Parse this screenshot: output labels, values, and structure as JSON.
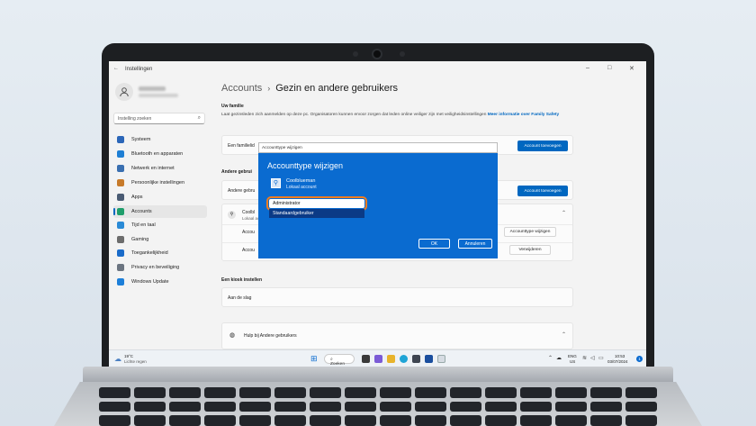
{
  "window": {
    "back_glyph": "←",
    "title": "Instellingen",
    "min": "–",
    "max": "□",
    "close": "✕"
  },
  "sidebar": {
    "search_placeholder": "Instelling zoeken",
    "items": [
      {
        "label": "Systeem",
        "icon": "monitor-icon",
        "color": "#2b66b8"
      },
      {
        "label": "Bluetooth en apparaten",
        "icon": "bluetooth-icon",
        "color": "#1f7fd4"
      },
      {
        "label": "Netwerk en internet",
        "icon": "wifi-icon",
        "color": "#3a6fb0"
      },
      {
        "label": "Persoonlijke instellingen",
        "icon": "brush-icon",
        "color": "#c77a2a"
      },
      {
        "label": "Apps",
        "icon": "apps-icon",
        "color": "#4a5b73"
      },
      {
        "label": "Accounts",
        "icon": "accounts-icon",
        "color": "#1f9e6b"
      },
      {
        "label": "Tijd en taal",
        "icon": "globe-icon",
        "color": "#2a8ad6"
      },
      {
        "label": "Gaming",
        "icon": "gamepad-icon",
        "color": "#6c6c6c"
      },
      {
        "label": "Toegankelijkheid",
        "icon": "accessibility-icon",
        "color": "#1a6bc9"
      },
      {
        "label": "Privacy en beveiliging",
        "icon": "shield-icon",
        "color": "#6b7480"
      },
      {
        "label": "Windows Update",
        "icon": "update-icon",
        "color": "#1d7fd9"
      }
    ],
    "active_index": 5
  },
  "main": {
    "breadcrumb_parent": "Accounts",
    "breadcrumb_sep": "›",
    "page_title": "Gezin en andere gebruikers",
    "family_heading": "Uw familie",
    "family_desc": "Laat gezinsleden zich aanmelden op deze pc. Organisatoren kunnen ervoor zorgen dat leden online veiliger zijn met veiligheidsinstellingen",
    "family_link": "Meer informatie over Family Safety",
    "family_card_label": "Een familielid",
    "add_account_label": "Account toevoegen",
    "other_heading": "Andere gebrui",
    "other_card_label": "Andere gebru",
    "other_add_label": "Account toevoegen",
    "user_name": "Coolbl",
    "user_sub": "Lokaal ac",
    "account_opt_label": "Accou",
    "account_data_label": "Accou",
    "change_type_label": "Accounttype wijzigen",
    "remove_label": "Verwijderen",
    "kiosk_heading": "Een kiosk instellen",
    "kiosk_card_label": "Aan de slag",
    "help_label": "Hulp bij Andere gebruikers"
  },
  "dialog": {
    "input_value": "Accounttype wijzigen",
    "title": "Accounttype wijzigen",
    "user_name": "Coolblueman",
    "user_type": "Lokaal account",
    "options": [
      "Administrator",
      "Standaardgebruiker"
    ],
    "selected": "Administrator",
    "ok_label": "OK",
    "cancel_label": "Annuleren",
    "highlight_color": "#f07c1f"
  },
  "taskbar": {
    "weather_temp": "19°C",
    "weather_desc": "Lichte regen",
    "search_label": "Zoeken",
    "lang_top": "ENG",
    "lang_bottom": "US",
    "time": "10:53",
    "date": "03/07/2024",
    "notification_count": "1"
  }
}
